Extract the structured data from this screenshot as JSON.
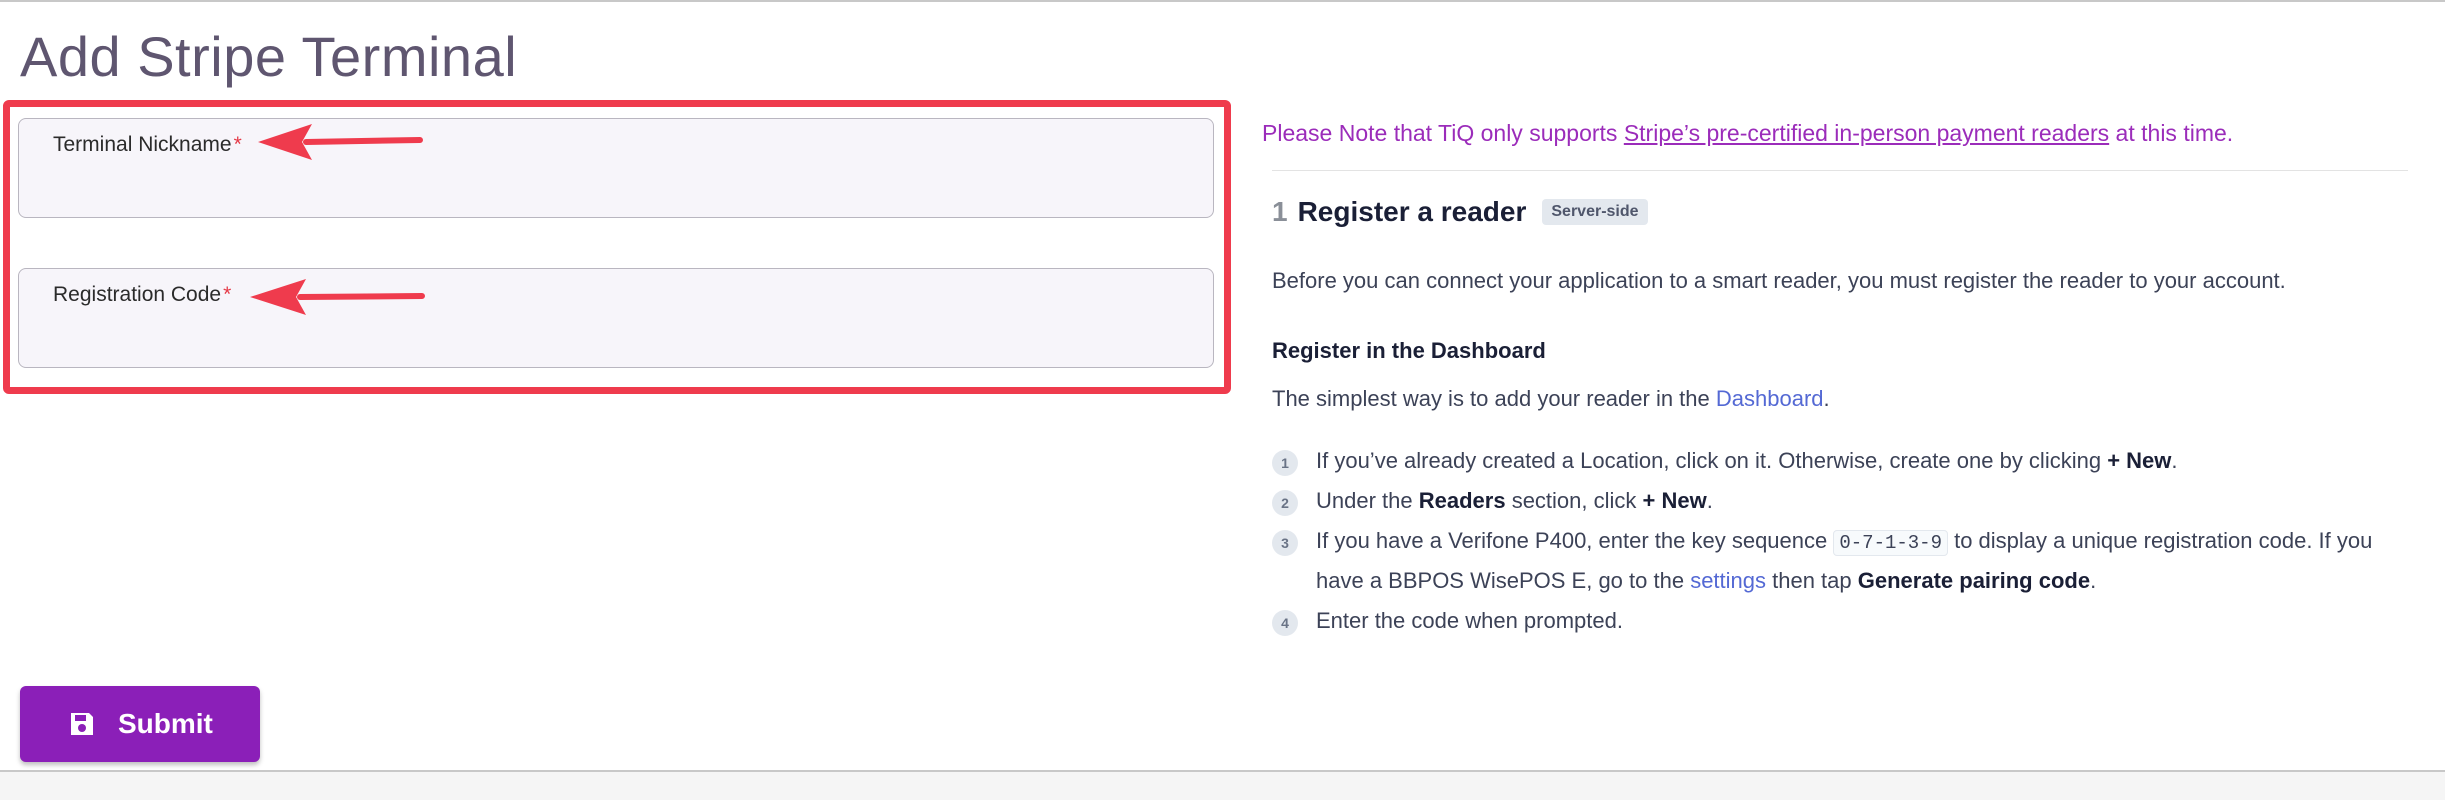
{
  "page": {
    "title": "Add Stripe Terminal"
  },
  "form": {
    "nickname_label": "Terminal Nickname",
    "nickname_value": "",
    "code_label": "Registration Code",
    "code_value": "",
    "required_mark": "*",
    "submit_label": "Submit"
  },
  "annotation": {
    "highlight_color": "#ef3b4d"
  },
  "colors": {
    "accent": "#8b1fb8",
    "note": "#9b2cba",
    "link": "#5469d4",
    "title": "#5f5670"
  },
  "icons": {
    "submit": "save-icon",
    "arrow": "red-arrow-left"
  },
  "info": {
    "note_before": "Please Note that TiQ only supports ",
    "note_link": "Stripe’s pre-certified in-person payment readers",
    "note_after": " at this time.",
    "step_number": "1",
    "step_title": "Register a reader",
    "step_badge": "Server-side",
    "intro": "Before you can connect your application to a smart reader, you must register the reader to your account.",
    "subheading": "Register in the Dashboard",
    "simple_before": "The simplest way is to add your reader in the ",
    "simple_link": "Dashboard",
    "simple_after": ".",
    "steps": [
      {
        "num": "1",
        "t1": "If you’ve already created a Location, click on it. Otherwise, create one by clicking ",
        "b1": "+ New",
        "t2": "."
      },
      {
        "num": "2",
        "t1": "Under the ",
        "b1": "Readers",
        "t2": " section, click ",
        "b2": "+ New",
        "t3": "."
      },
      {
        "num": "3",
        "t1": "If you have a Verifone P400, enter the key sequence ",
        "code": "0-7-1-3-9",
        "t2": " to display a unique registration code. If you have a BBPOS WisePOS E, go to the ",
        "link": "settings",
        "t3": " then tap ",
        "b1": "Generate pairing code",
        "t4": "."
      },
      {
        "num": "4",
        "t1": "Enter the code when prompted."
      }
    ]
  }
}
